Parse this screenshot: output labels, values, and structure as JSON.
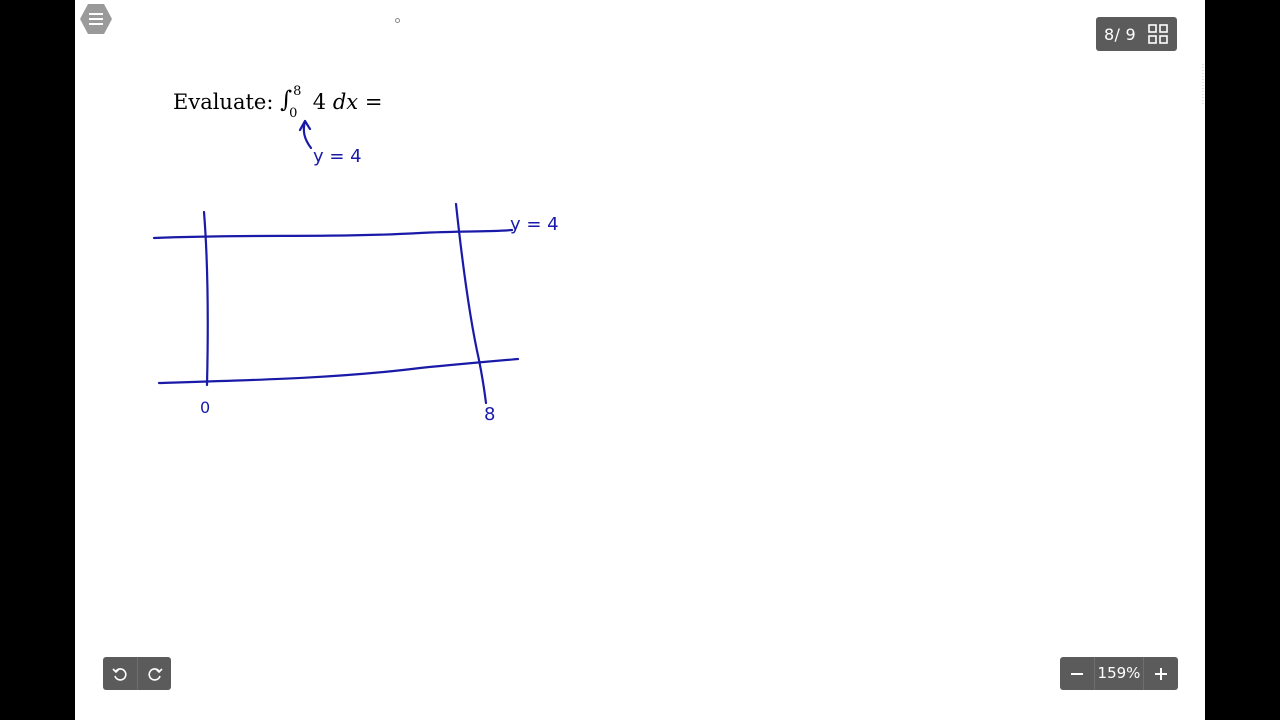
{
  "header": {
    "menu_icon": "hamburger-menu-icon",
    "page_current": "8",
    "page_total": "9",
    "page_indicator": "8/ 9",
    "grid_icon": "grid-view-icon"
  },
  "question": {
    "prefix": "Evaluate:",
    "integral_sign": "∫",
    "upper_limit": "8",
    "lower_limit": "0",
    "integrand": "4",
    "differential": "dx",
    "equals": "="
  },
  "annotations": {
    "arrow_label": "y = 4",
    "line_label": "y = 4",
    "left_tick": "0",
    "right_tick": "8"
  },
  "toolbar": {
    "undo_icon": "undo-icon",
    "redo_icon": "redo-icon"
  },
  "zoom": {
    "minus_label": "−",
    "value": "159%",
    "plus_label": "+"
  },
  "colors": {
    "ink": "#1a1aa8",
    "toolbar_bg": "#5b5b5b",
    "page_bg": "#ffffff",
    "backdrop": "#000000"
  }
}
